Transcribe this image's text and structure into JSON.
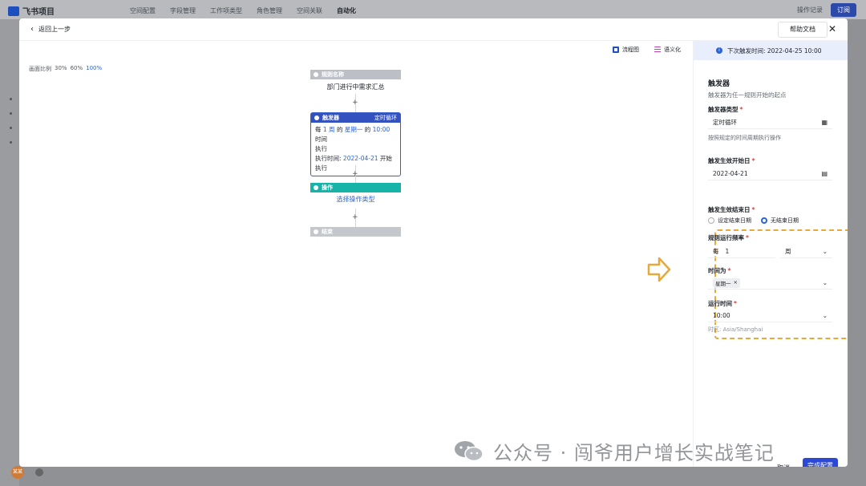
{
  "background": {
    "app_name": "飞书项目",
    "tabs": [
      "空间配置",
      "字段管理",
      "工作项类型",
      "角色管理",
      "空间关联",
      "自动化"
    ],
    "active_tab": "自动化",
    "right_link": "操作记录",
    "right_button": "订阅",
    "avatar": "某某"
  },
  "modal": {
    "back_label": "返回上一步",
    "help_label": "帮助文档",
    "close_icon": "close-icon"
  },
  "canvas": {
    "view_diagram": "流程图",
    "view_text": "语义化",
    "zoom_label": "画面比例",
    "zoom_options": [
      "30%",
      "60%",
      "100%"
    ],
    "active_zoom": "100%",
    "rule_node": {
      "title": "规则名称",
      "body": "部门进行中需求汇总"
    },
    "trigger_node": {
      "title": "触发器",
      "tag": "定时循环",
      "line1_a": "每",
      "line1_b": "1 周",
      "line1_c": "的",
      "line1_d": "星期一",
      "line1_e": "的",
      "line1_f": "10:00",
      "line1_g": "时间",
      "line2": "执行",
      "line3_a": "执行时间:",
      "line3_b": "2022-04-21",
      "line3_c": "开始",
      "line4": "执行"
    },
    "action_node": {
      "title": "操作",
      "body": "选择操作类型"
    },
    "end_node": {
      "title": "结束"
    },
    "plus": "+"
  },
  "panel": {
    "next_trigger": "下次触发时间: 2022-04-25 10:00",
    "title": "触发器",
    "desc": "触发器为任一规则开始的起点",
    "type_label": "触发器类型",
    "type_value": "定时循环",
    "type_hint": "按照规定的时间周期执行操作",
    "start_label": "触发生效开始日",
    "start_value": "2022-04-21",
    "end_label": "触发生效结束日",
    "end_options": [
      "设定结束日期",
      "无结束日期"
    ],
    "end_selected": "无结束日期",
    "freq_label": "规则运行频率",
    "freq_prefix": "每",
    "freq_num": "1",
    "freq_unit": "周",
    "when_label": "时间为",
    "when_tag": "星期一",
    "runtime_label": "运行时间",
    "runtime_value": "10:00",
    "timezone": "时区: Asia/Shanghai",
    "cancel_label": "取消",
    "done_label": "完成配置"
  },
  "watermark": "公众号 · 闯爷用户增长实战笔记",
  "colors": {
    "accent": "#2a63d6",
    "trigger": "#3352c0",
    "action": "#15b3a8",
    "highlight": "#e8a93c"
  }
}
